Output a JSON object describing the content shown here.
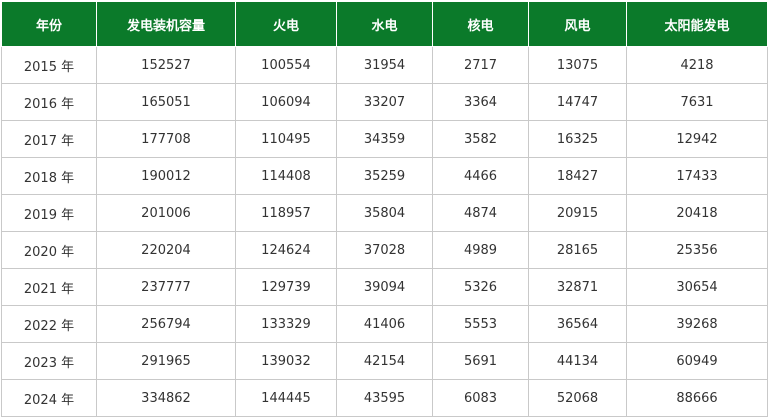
{
  "table": {
    "headers": [
      "年份",
      "发电装机容量",
      "火电",
      "水电",
      "核电",
      "风电",
      "太阳能发电"
    ],
    "rows": [
      [
        "2015 年",
        "152527",
        "100554",
        "31954",
        "2717",
        "13075",
        "4218"
      ],
      [
        "2016 年",
        "165051",
        "106094",
        "33207",
        "3364",
        "14747",
        "7631"
      ],
      [
        "2017 年",
        "177708",
        "110495",
        "34359",
        "3582",
        "16325",
        "12942"
      ],
      [
        "2018 年",
        "190012",
        "114408",
        "35259",
        "4466",
        "18427",
        "17433"
      ],
      [
        "2019 年",
        "201006",
        "118957",
        "35804",
        "4874",
        "20915",
        "20418"
      ],
      [
        "2020 年",
        "220204",
        "124624",
        "37028",
        "4989",
        "28165",
        "25356"
      ],
      [
        "2021 年",
        "237777",
        "129739",
        "39094",
        "5326",
        "32871",
        "30654"
      ],
      [
        "2022 年",
        "256794",
        "133329",
        "41406",
        "5553",
        "36564",
        "39268"
      ],
      [
        "2023 年",
        "291965",
        "139032",
        "42154",
        "5691",
        "44134",
        "60949"
      ],
      [
        "2024 年",
        "334862",
        "144445",
        "43595",
        "6083",
        "52068",
        "88666"
      ]
    ]
  },
  "colors": {
    "header_background": "#0b7a2a",
    "header_text": "#ffffff",
    "cell_text": "#333333",
    "border": "#c9c9c9"
  }
}
